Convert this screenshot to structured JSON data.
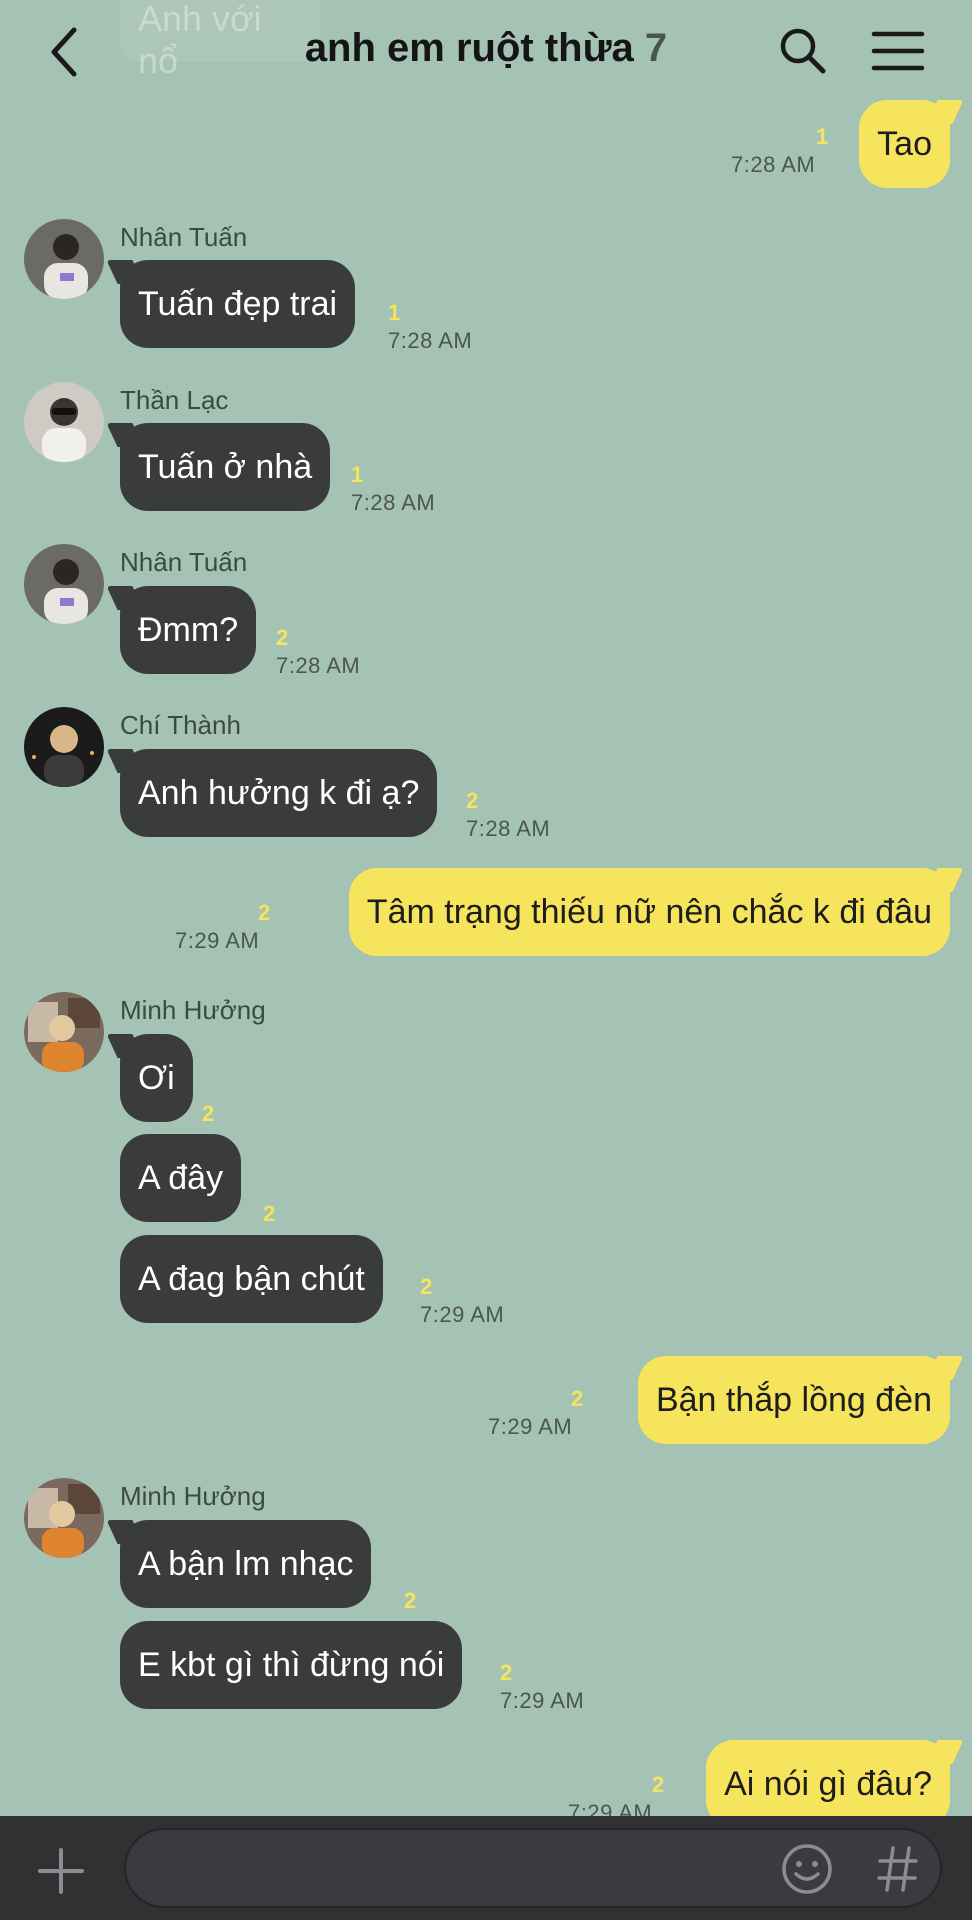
{
  "header": {
    "prev_message": "Anh với nổ",
    "title": "anh em ruột thừa",
    "member_count": "7"
  },
  "messages": [
    {
      "from": "me",
      "text": "Tao",
      "unread": "1",
      "time": "7:28 AM"
    },
    {
      "from": "Nhân Tuấn",
      "text": "Tuấn đẹp trai",
      "unread": "1",
      "time": "7:28 AM"
    },
    {
      "from": "Thần Lạc",
      "text": "Tuấn ở nhà",
      "unread": "1",
      "time": "7:28 AM"
    },
    {
      "from": "Nhân Tuấn",
      "text": "Đmm?",
      "unread": "2",
      "time": "7:28 AM"
    },
    {
      "from": "Chí Thành",
      "text": "Anh hưởng k đi ạ?",
      "unread": "2",
      "time": "7:28 AM"
    },
    {
      "from": "me",
      "text": "Tâm trạng thiếu nữ nên chắc k đi đâu",
      "unread": "2",
      "time": "7:29 AM"
    },
    {
      "from": "Minh Hưởng",
      "text": "Ơi",
      "unread": "2",
      "time": ""
    },
    {
      "from": "Minh Hưởng",
      "text": "A đây",
      "unread": "2",
      "time": ""
    },
    {
      "from": "Minh Hưởng",
      "text": "A đag bận chút",
      "unread": "2",
      "time": "7:29 AM"
    },
    {
      "from": "me",
      "text": "Bận thắp lồng đèn",
      "unread": "2",
      "time": "7:29 AM"
    },
    {
      "from": "Minh Hưởng",
      "text": "A bận lm nhạc",
      "unread": "2",
      "time": ""
    },
    {
      "from": "Minh Hưởng",
      "text": "E kbt gì thì đừng nói",
      "unread": "2",
      "time": "7:29 AM"
    },
    {
      "from": "me",
      "text": "Ai nói gì đâu?",
      "unread": "2",
      "time": "7:29 AM"
    }
  ],
  "input": {
    "placeholder": ""
  },
  "colors": {
    "background": "#a5c3b4",
    "incoming": "#3a3b3d",
    "outgoing": "#f6e45c",
    "unread": "#f6e45c"
  },
  "icons": [
    "back-arrow-icon",
    "search-icon",
    "menu-icon",
    "plus-icon",
    "emoji-icon",
    "hashtag-icon"
  ]
}
